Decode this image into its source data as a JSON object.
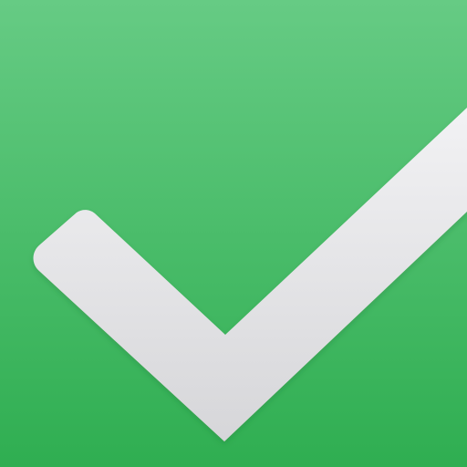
{
  "icon": {
    "name": "checkmark-icon",
    "colors": {
      "background_top": "#66CB84",
      "background_bottom": "#2FAE51",
      "check_top": "#F2F2F4",
      "check_bottom": "#D6D6D9"
    }
  }
}
